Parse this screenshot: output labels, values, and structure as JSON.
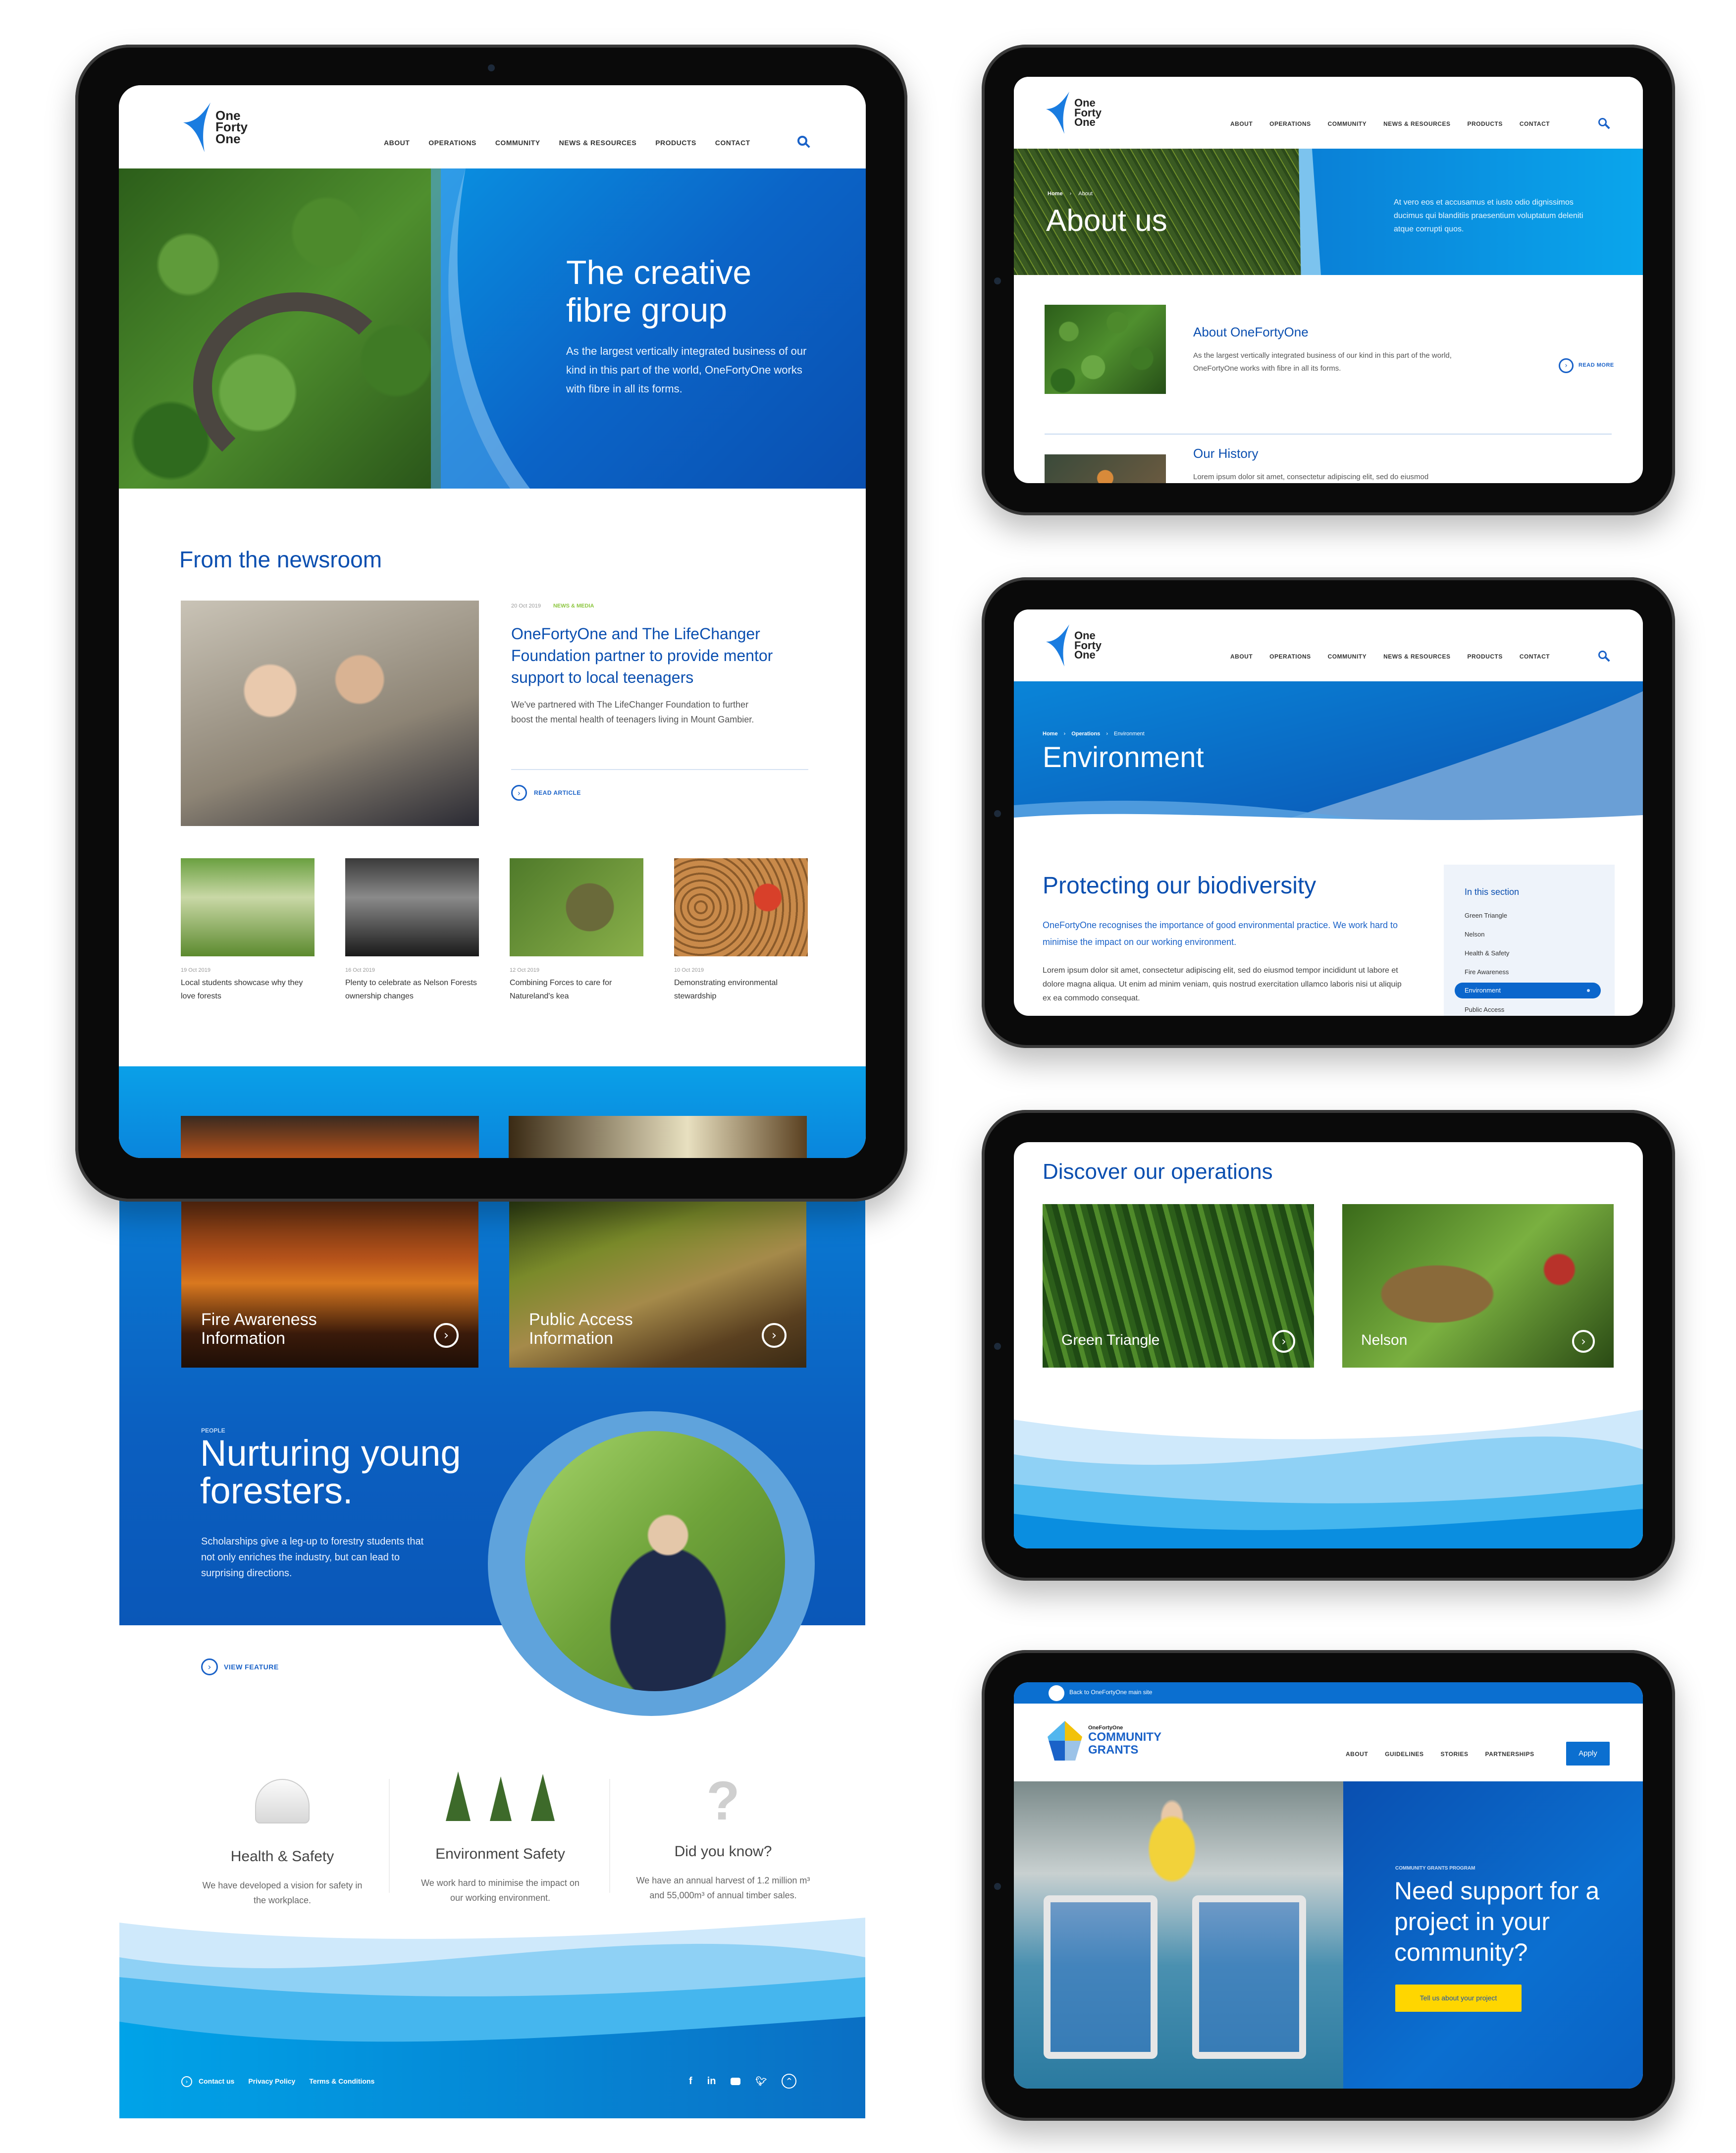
{
  "brand": {
    "logo_lines": [
      "One",
      "Forty",
      "One"
    ],
    "primary_color": "#0b4fb0",
    "accent_color": "#00a3e0",
    "highlight_color": "#8cc63f"
  },
  "nav": {
    "items": [
      "ABOUT",
      "OPERATIONS",
      "COMMUNITY",
      "NEWS & RESOURCES",
      "PRODUCTS",
      "CONTACT"
    ],
    "search_icon": "search-icon"
  },
  "home": {
    "hero": {
      "title_line1": "The creative",
      "title_line2": "fibre group",
      "body": "As the largest vertically integrated business of our kind in this part of the world, OneFortyOne works with fibre in all its forms."
    },
    "newsroom": {
      "heading": "From the newsroom",
      "featured": {
        "date": "20 Oct 2019",
        "category": "NEWS & MEDIA",
        "title": "OneFortyOne and The LifeChanger Foundation partner to provide mentor support to local teenagers",
        "excerpt": "We've partnered with The LifeChanger Foundation to further boost the mental health of teenagers living in Mount Gambier.",
        "cta": "READ ARTICLE"
      },
      "articles": [
        {
          "date": "19 Oct 2019",
          "title": "Local students showcase why they love forests"
        },
        {
          "date": "16 Oct 2019",
          "title": "Plenty to celebrate as Nelson Forests ownership changes"
        },
        {
          "date": "12 Oct 2019",
          "title": "Combining Forces to care for Natureland's kea"
        },
        {
          "date": "10 Oct 2019",
          "title": "Demonstrating environmental stewardship"
        }
      ]
    },
    "info_cards": [
      {
        "line1": "Fire Awareness",
        "line2": "Information"
      },
      {
        "line1": "Public Access",
        "line2": "Information"
      }
    ],
    "feature": {
      "eyebrow": "PEOPLE",
      "title_line1": "Nurturing young",
      "title_line2": "foresters.",
      "body": "Scholarships give a leg-up to forestry students that not only enriches the industry, but can lead to surprising directions.",
      "cta": "VIEW FEATURE"
    },
    "highlights": [
      {
        "icon": "hard-hat-icon",
        "title": "Health & Safety",
        "body": "We have developed a vision for safety in the workplace."
      },
      {
        "icon": "trees-icon",
        "title": "Environment Safety",
        "body": "We work hard to minimise the impact on our working environment."
      },
      {
        "icon": "question-mark-icon",
        "title": "Did you know?",
        "body": "We have an annual harvest of 1.2 million m³ and 55,000m³ of annual timber sales."
      }
    ],
    "footer": {
      "links": [
        "Contact us",
        "Privacy Policy",
        "Terms & Conditions"
      ],
      "social": [
        "facebook-icon",
        "linkedin-icon",
        "youtube-icon",
        "twitter-icon"
      ],
      "back_to_top": "back-to-top-icon"
    }
  },
  "about": {
    "breadcrumb": [
      "Home",
      "About"
    ],
    "title": "About us",
    "intro": "At vero eos et accusamus et iusto odio dignissimos ducimus qui blanditiis praesentium voluptatum deleniti atque corrupti quos.",
    "items": [
      {
        "title": "About OneFortyOne",
        "body": "As the largest vertically integrated business of our kind in this part of the world, OneFortyOne works with fibre in all its forms.",
        "cta": "READ MORE"
      },
      {
        "title": "Our History",
        "body": "Lorem ipsum dolor sit amet, consectetur adipiscing elit, sed do eiusmod"
      }
    ]
  },
  "environment": {
    "breadcrumb": [
      "Home",
      "Operations",
      "Environment"
    ],
    "title": "Environment",
    "heading": "Protecting our biodiversity",
    "lead": "OneFortyOne recognises the importance of good environmental practice. We work hard to minimise the impact on our working environment.",
    "body": "Lorem ipsum dolor sit amet, consectetur adipiscing elit, sed do eiusmod tempor incididunt ut labore et dolore magna aliqua. Ut enim ad minim veniam, quis nostrud exercitation ullamco laboris nisi ut aliquip ex ea commodo consequat.",
    "section_nav": {
      "heading": "In this section",
      "items": [
        "Green Triangle",
        "Nelson",
        "Health & Safety",
        "Fire Awareness",
        "Environment",
        "Public Access"
      ],
      "active": "Environment"
    }
  },
  "operations": {
    "heading": "Discover our operations",
    "cards": [
      "Green Triangle",
      "Nelson"
    ]
  },
  "grants": {
    "topbar": "Back to OneFortyOne main site",
    "logo_small": "OneFortyOne",
    "logo_line1": "COMMUNITY",
    "logo_line2": "GRANTS",
    "nav": [
      "ABOUT",
      "GUIDELINES",
      "STORIES",
      "PARTNERSHIPS"
    ],
    "apply": "Apply",
    "eyebrow": "COMMUNITY GRANTS PROGRAM",
    "title": "Need support for a project in your community?",
    "cta": "Tell us about your project"
  }
}
